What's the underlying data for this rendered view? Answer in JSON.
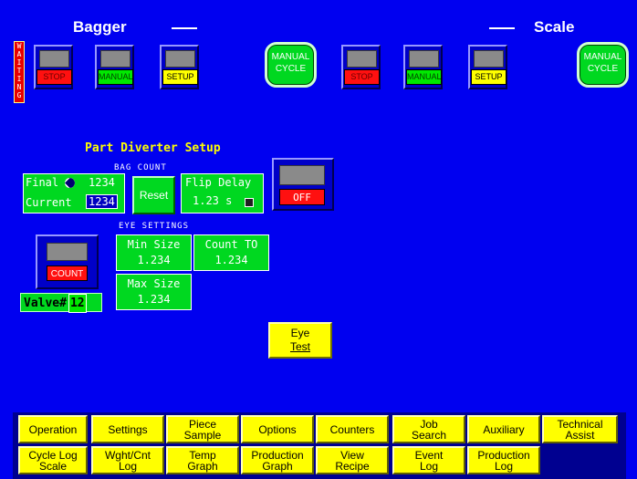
{
  "header": {
    "left_title": "Bagger",
    "right_title": "Scale"
  },
  "status": {
    "waiting_label": "WAITING",
    "waiting_letters": [
      "W",
      "A",
      "I",
      "T",
      "I",
      "N",
      "G"
    ]
  },
  "bagger_controls": [
    {
      "label": "STOP",
      "color": "red"
    },
    {
      "label": "MANUAL",
      "color": "green"
    },
    {
      "label": "SETUP",
      "color": "yellow"
    }
  ],
  "scale_controls": [
    {
      "label": "STOP",
      "color": "red"
    },
    {
      "label": "MANUAL",
      "color": "green"
    },
    {
      "label": "SETUP",
      "color": "yellow"
    }
  ],
  "manual_cycle": {
    "line1": "MANUAL",
    "line2": "CYCLE"
  },
  "diverter": {
    "title": "Part Diverter Setup",
    "bag_count_label": "BAG COUNT",
    "final_label": "Final",
    "final_value": "1234",
    "current_label": "Current",
    "current_value": "1234",
    "reset_label": "Reset",
    "flip_delay_label": "Flip Delay",
    "flip_delay_value": "1.23 s",
    "off_label": "OFF",
    "eye_settings_label": "EYE SETTINGS",
    "count_label": "COUNT",
    "min_size_label": "Min Size",
    "min_size_value": "1.234",
    "count_to_label": "Count TO",
    "count_to_value": "1.234",
    "max_size_label": "Max Size",
    "max_size_value": "1.234",
    "valve_label": "Valve#",
    "valve_value": "12",
    "eye_test_line1": "Eye",
    "eye_test_line2": "Test"
  },
  "nav_row1": [
    {
      "lines": [
        "Operation"
      ]
    },
    {
      "lines": [
        "Settings"
      ]
    },
    {
      "lines": [
        "Piece",
        "Sample"
      ]
    },
    {
      "lines": [
        "Options"
      ]
    },
    {
      "lines": [
        "Counters"
      ]
    },
    {
      "lines": [
        "Job",
        "Search"
      ]
    },
    {
      "lines": [
        "Auxiliary"
      ]
    },
    {
      "lines": [
        "Technical",
        "Assist"
      ]
    }
  ],
  "nav_row2": [
    {
      "lines": [
        "Cycle Log",
        "Scale"
      ]
    },
    {
      "lines": [
        "Wght/Cnt",
        "Log"
      ]
    },
    {
      "lines": [
        "Temp",
        "Graph"
      ]
    },
    {
      "lines": [
        "Production",
        "Graph"
      ]
    },
    {
      "lines": [
        "View",
        "Recipe"
      ]
    },
    {
      "lines": [
        "Event",
        "Log"
      ]
    },
    {
      "lines": [
        "Production",
        "Log"
      ]
    }
  ],
  "colors": {
    "background": "#0000f0",
    "accent_yellow": "#ffff00",
    "accent_green": "#00d820",
    "stop_red": "#ff1010"
  }
}
